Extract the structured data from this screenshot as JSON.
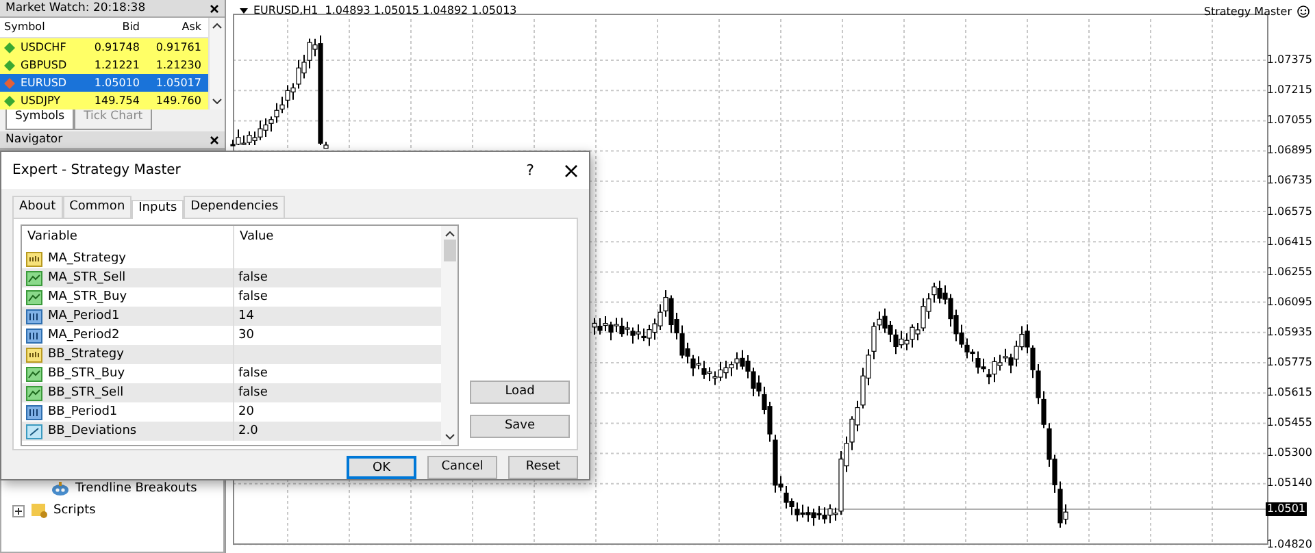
{
  "market_watch": {
    "title": "Market Watch: 20:18:38",
    "columns": [
      "Symbol",
      "Bid",
      "Ask"
    ],
    "rows": [
      {
        "symbol": "USDCHF",
        "bid": "0.91748",
        "ask": "0.91761",
        "selected": false,
        "color": "#3aa832"
      },
      {
        "symbol": "GBPUSD",
        "bid": "1.21221",
        "ask": "1.21230",
        "selected": false,
        "color": "#3aa832"
      },
      {
        "symbol": "EURUSD",
        "bid": "1.05010",
        "ask": "1.05017",
        "selected": true,
        "color": "#e0603a"
      },
      {
        "symbol": "USDJPY",
        "bid": "149.754",
        "ask": "149.760",
        "selected": false,
        "color": "#3aa832"
      }
    ],
    "tabs": [
      {
        "label": "Symbols",
        "selected": true
      },
      {
        "label": "Tick Chart",
        "selected": false
      }
    ]
  },
  "navigator": {
    "title": "Navigator",
    "items": [
      {
        "label": "Trendline Breakouts",
        "kind": "expert"
      },
      {
        "label": "Scripts",
        "kind": "folder",
        "expanded": false
      }
    ]
  },
  "chart": {
    "header": "EURUSD,H1  1.04893 1.05015 1.04892 1.05013",
    "expert": "Strategy Master",
    "price_labels": [
      "1.07375",
      "1.07215",
      "1.07055",
      "1.06895",
      "1.06735",
      "1.06575",
      "1.06415",
      "1.06255",
      "1.06095",
      "1.05935",
      "1.05775",
      "1.05615",
      "1.05455",
      "1.05300",
      "1.05140",
      "1.04820"
    ],
    "current_price": "1.0501"
  },
  "dialog": {
    "title": "Expert - Strategy Master",
    "help": "?",
    "tabs": [
      {
        "label": "About",
        "selected": false
      },
      {
        "label": "Common",
        "selected": false
      },
      {
        "label": "Inputs",
        "selected": true
      },
      {
        "label": "Dependencies",
        "selected": false
      }
    ],
    "columns": [
      "Variable",
      "Value"
    ],
    "rows": [
      {
        "kind": "string",
        "variable": "MA_Strategy"
      },
      {
        "kind": "bool",
        "variable": "MA_STR_Sell",
        "value": "false"
      },
      {
        "kind": "bool",
        "variable": "MA_STR_Buy",
        "value": "false"
      },
      {
        "kind": "int",
        "variable": "MA_Period1",
        "value": "14"
      },
      {
        "kind": "int",
        "variable": "MA_Period2",
        "value": "30"
      },
      {
        "kind": "string",
        "variable": "BB_Strategy"
      },
      {
        "kind": "bool",
        "variable": "BB_STR_Buy",
        "value": "false"
      },
      {
        "kind": "bool",
        "variable": "BB_STR_Sell",
        "value": "false"
      },
      {
        "kind": "int",
        "variable": "BB_Period1",
        "value": "20"
      },
      {
        "kind": "double",
        "variable": "BB_Deviations",
        "value": "2.0"
      }
    ],
    "side_buttons": [
      "Load",
      "Save"
    ],
    "buttons": [
      {
        "label": "OK",
        "default": true
      },
      {
        "label": "Cancel",
        "default": false
      },
      {
        "label": "Reset",
        "default": false
      }
    ]
  }
}
